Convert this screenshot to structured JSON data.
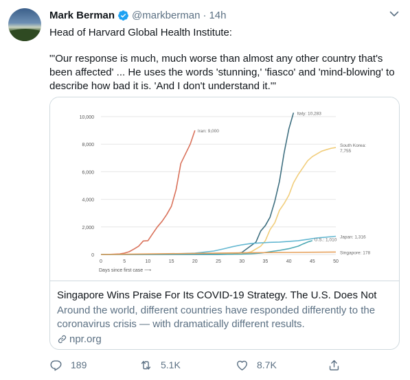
{
  "tweet": {
    "name": "Mark Berman",
    "handle": "@markberman",
    "separator": "·",
    "time": "14h",
    "text_line1": "Head of Harvard Global Health Institute:",
    "text_quote": "\"'Our response is much, much worse than almost any other country that's been affected' ... He uses the words 'stunning,' 'fiasco' and 'mind-blowing' to describe how bad it is. 'And I don't understand it.'\""
  },
  "card": {
    "title": "Singapore Wins Praise For Its COVID-19 Strategy. The U.S. Does Not",
    "description": "Around the world, different countries have responded differently to the coronavirus crisis — with dramatically different results.",
    "domain": "npr.org"
  },
  "actions": {
    "replies": "189",
    "retweets": "5.1K",
    "likes": "8.7K"
  },
  "icons": {
    "verified": "verified-badge-icon",
    "caret": "chevron-down-icon",
    "reply": "reply-icon",
    "retweet": "retweet-icon",
    "like": "heart-icon",
    "share": "share-icon",
    "link": "link-icon"
  },
  "colors": {
    "verified": "#1da1f2",
    "secondary_text": "#5b7083",
    "border": "#cfd9de"
  },
  "chart_data": {
    "type": "line",
    "xlabel": "Days since first case ⟶",
    "ylabel": "",
    "xlim": [
      0,
      50
    ],
    "ylim": [
      0,
      10000
    ],
    "x_ticks": [
      0,
      5,
      10,
      15,
      20,
      25,
      30,
      35,
      40,
      45,
      50
    ],
    "y_ticks": [
      0,
      2000,
      4000,
      6000,
      8000,
      10000
    ],
    "y_tick_labels": [
      "0",
      "2,000",
      "4,000",
      "6,000",
      "8,000",
      "10,000"
    ],
    "grid": true,
    "series": [
      {
        "name": "Iran",
        "label": "Iran: 9,000",
        "color": "#d9715a",
        "x": [
          0,
          2,
          4,
          5,
          6,
          7,
          8,
          9,
          10,
          11,
          12,
          13,
          14,
          15,
          16,
          17,
          18,
          19,
          20
        ],
        "y": [
          0,
          10,
          40,
          100,
          200,
          390,
          590,
          980,
          1000,
          1500,
          2000,
          2400,
          2900,
          3500,
          4700,
          6600,
          7300,
          8000,
          9000
        ]
      },
      {
        "name": "Italy",
        "label": "Italy: 10,283",
        "color": "#3e6f80",
        "x": [
          0,
          5,
          10,
          15,
          20,
          25,
          28,
          30,
          31,
          32,
          33,
          34,
          35,
          36,
          37,
          38,
          39,
          40,
          41
        ],
        "y": [
          0,
          3,
          3,
          3,
          3,
          3,
          20,
          150,
          400,
          650,
          900,
          1700,
          2100,
          2700,
          3850,
          5300,
          7400,
          9100,
          10283
        ]
      },
      {
        "name": "South Korea",
        "label": "South Korea: 7,755",
        "color": "#f1cd7a",
        "x": [
          0,
          10,
          20,
          30,
          32,
          34,
          35,
          36,
          37,
          38,
          39,
          40,
          41,
          42,
          43,
          44,
          45,
          46,
          47,
          48,
          49,
          50
        ],
        "y": [
          0,
          20,
          30,
          30,
          200,
          600,
          1000,
          1800,
          2300,
          3200,
          3700,
          4300,
          5200,
          5800,
          6300,
          6800,
          7100,
          7300,
          7500,
          7600,
          7700,
          7755
        ]
      },
      {
        "name": "Japan",
        "label": "Japan: 1,316",
        "color": "#63b7d1",
        "x": [
          0,
          10,
          15,
          20,
          22,
          24,
          26,
          28,
          30,
          32,
          34,
          36,
          38,
          40,
          42,
          44,
          46,
          48,
          50
        ],
        "y": [
          0,
          15,
          30,
          100,
          170,
          250,
          400,
          560,
          700,
          800,
          840,
          880,
          900,
          950,
          1000,
          1100,
          1200,
          1260,
          1316
        ]
      },
      {
        "name": "U.S.",
        "label": "U.S.: 1,010",
        "color": "#4aa7b3",
        "x": [
          0,
          10,
          20,
          25,
          30,
          32,
          34,
          36,
          38,
          40,
          42,
          43,
          44,
          45
        ],
        "y": [
          0,
          12,
          14,
          15,
          25,
          50,
          100,
          200,
          300,
          420,
          600,
          760,
          900,
          1010
        ]
      },
      {
        "name": "Singapore",
        "label": "Singapore: 178",
        "color": "#e6a05a",
        "x": [
          0,
          10,
          20,
          30,
          40,
          50
        ],
        "y": [
          0,
          40,
          80,
          120,
          150,
          178
        ]
      }
    ]
  }
}
